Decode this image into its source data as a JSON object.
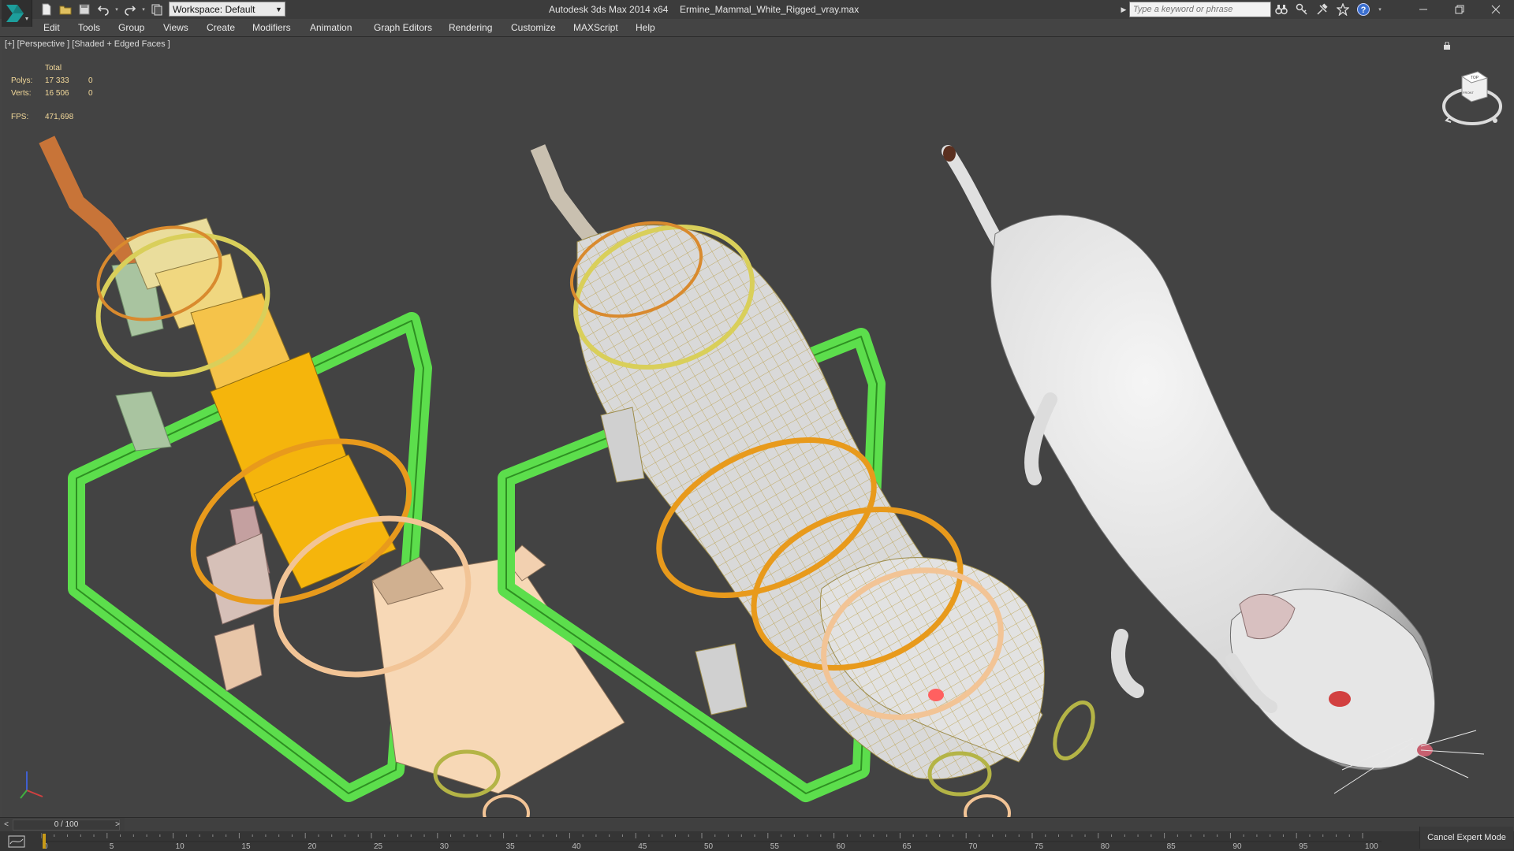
{
  "titlebar": {
    "app_title": "Autodesk 3ds Max  2014 x64",
    "file_title": "Ermine_Mammal_White_Rigged_vray.max",
    "workspace": "Workspace: Default",
    "search_placeholder": "Type a keyword or phrase"
  },
  "menu": {
    "items": [
      "Edit",
      "Tools",
      "Group",
      "Views",
      "Create",
      "Modifiers",
      "Animation",
      "Graph Editors",
      "Rendering",
      "Customize",
      "MAXScript",
      "Help"
    ]
  },
  "viewport": {
    "label": "[+] [Perspective ] [Shaded + Edged Faces ]",
    "stats": {
      "header": "Total",
      "polys_label": "Polys:",
      "polys_total": "17 333",
      "polys_sel": "0",
      "verts_label": "Verts:",
      "verts_total": "16 506",
      "verts_sel": "0",
      "fps_label": "FPS:",
      "fps_value": "471,698"
    },
    "viewcube_top": "TOP",
    "viewcube_front": "FRONT"
  },
  "timeline": {
    "frame_label": "0 / 100",
    "ticks": [
      "0",
      "5",
      "10",
      "15",
      "20",
      "25",
      "30",
      "35",
      "40",
      "45",
      "50",
      "55",
      "60",
      "65",
      "70",
      "75",
      "80",
      "85",
      "90",
      "95",
      "100"
    ]
  },
  "status": {
    "cancel_expert": "Cancel Expert Mode"
  },
  "colors": {
    "bone_yellow": "#f5b50c",
    "control_green": "#5cde4c",
    "ring_orange": "#e89a1c",
    "ring_peach": "#f2c496",
    "ring_olive": "#b4b446",
    "fur_white": "#e4e4e4"
  }
}
